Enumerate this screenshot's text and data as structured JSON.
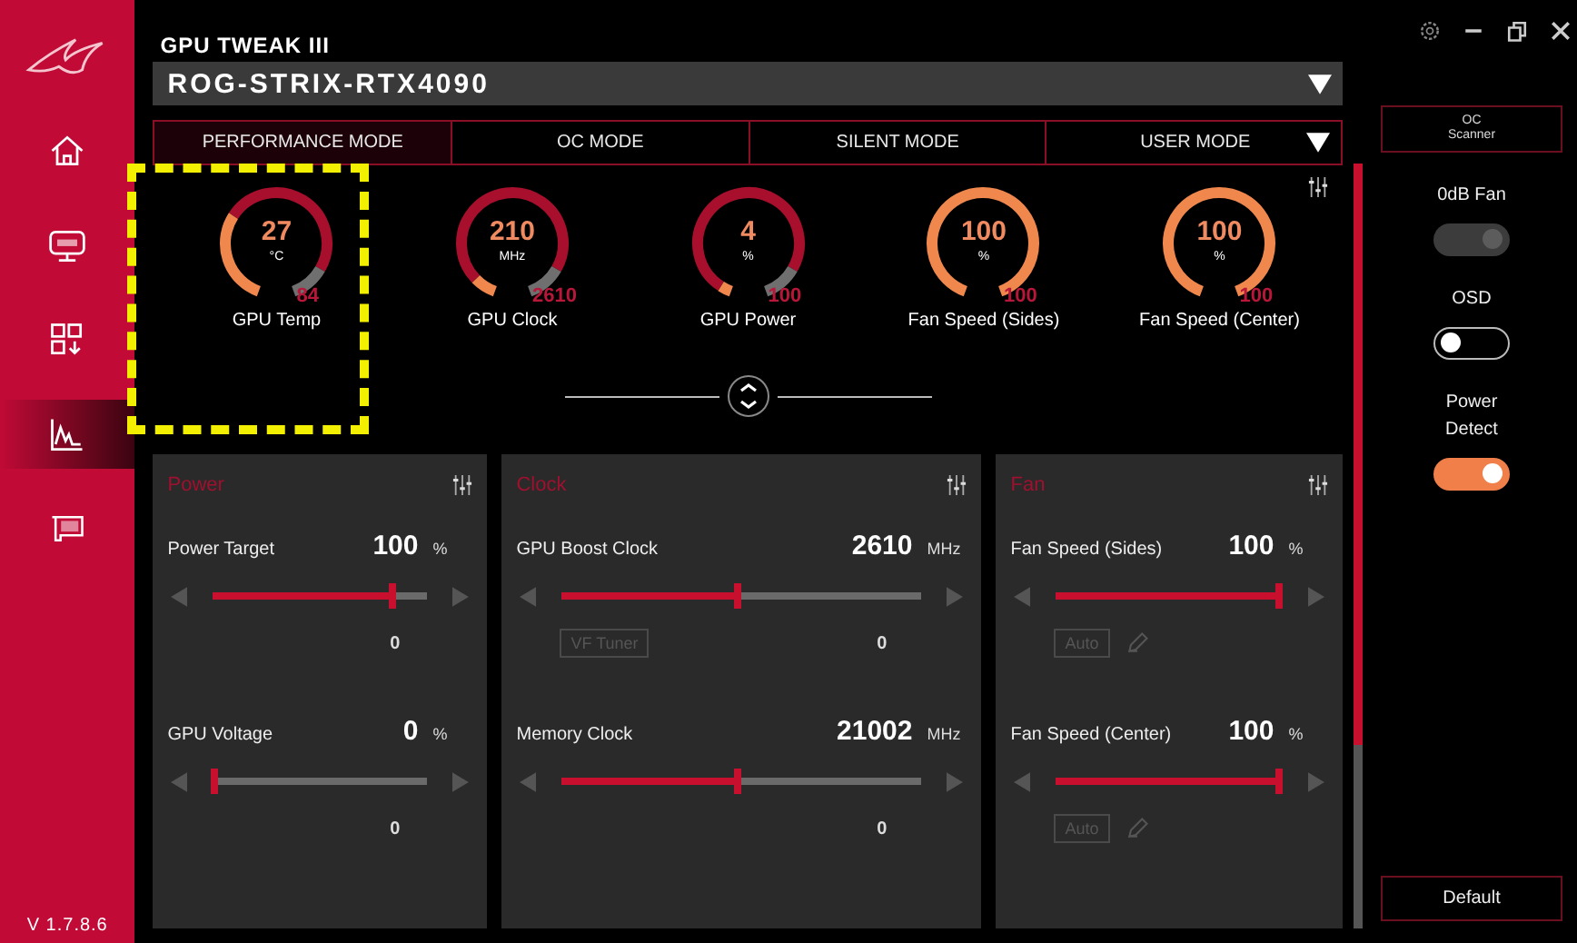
{
  "app": {
    "title": "GPU TWEAK III",
    "version": "V 1.7.8.6"
  },
  "sidebar": {
    "items": [
      {
        "kind": "home",
        "selected": false
      },
      {
        "kind": "osd",
        "selected": false
      },
      {
        "kind": "apps",
        "selected": false
      },
      {
        "kind": "monitor",
        "selected": true
      },
      {
        "kind": "gpuz",
        "selected": false
      }
    ]
  },
  "device": {
    "value": "ROG-STRIX-RTX4090"
  },
  "tabs": [
    {
      "label": "PERFORMANCE MODE",
      "selected": true
    },
    {
      "label": "OC MODE",
      "selected": false
    },
    {
      "label": "SILENT MODE",
      "selected": false
    },
    {
      "label": "USER MODE",
      "selected": false
    }
  ],
  "gauges": [
    {
      "value": "27",
      "unit": "°C",
      "max": "84",
      "label": "GPU Temp"
    },
    {
      "value": "210",
      "unit": "MHz",
      "max": "2610",
      "label": "GPU Clock"
    },
    {
      "value": "4",
      "unit": "%",
      "max": "100",
      "label": "GPU Power"
    },
    {
      "value": "100",
      "unit": "%",
      "max": "100",
      "label": "Fan Speed (Sides)"
    },
    {
      "value": "100",
      "unit": "%",
      "max": "100",
      "label": "Fan Speed (Center)"
    }
  ],
  "panels": [
    {
      "title": "Power",
      "controls": [
        {
          "label": "Power Target",
          "value": "100",
          "unit": "%",
          "level": 0.85,
          "reading": "0"
        },
        {
          "label": "GPU Voltage",
          "value": "0",
          "unit": "%",
          "level": 0.02,
          "reading": "0"
        }
      ]
    },
    {
      "title": "Clock",
      "controls": [
        {
          "label": "GPU Boost Clock",
          "value": "2610",
          "unit": "MHz",
          "level": 0.5,
          "reading": "0",
          "kind": "vf",
          "button": "VF Tuner"
        },
        {
          "label": "Memory Clock",
          "value": "21002",
          "unit": "MHz",
          "level": 0.5,
          "reading": "0"
        }
      ]
    },
    {
      "title": "Fan",
      "controls": [
        {
          "label": "Fan Speed (Sides)",
          "value": "100",
          "unit": "%",
          "level": 1,
          "kind": "auto",
          "button": "Auto"
        },
        {
          "label": "Fan Speed (Center)",
          "value": "100",
          "unit": "%",
          "level": 1,
          "kind": "auto",
          "button": "Auto"
        }
      ]
    }
  ],
  "right_panel": {
    "scanner": "OC\nScanner",
    "toggles": [
      {
        "label": "0dB Fan",
        "on": true,
        "disabled": true
      },
      {
        "label": "OSD",
        "on": false,
        "disabled": false
      },
      {
        "label": "Power\nDetect",
        "on": true,
        "disabled": false
      }
    ],
    "default_button": "Default"
  }
}
